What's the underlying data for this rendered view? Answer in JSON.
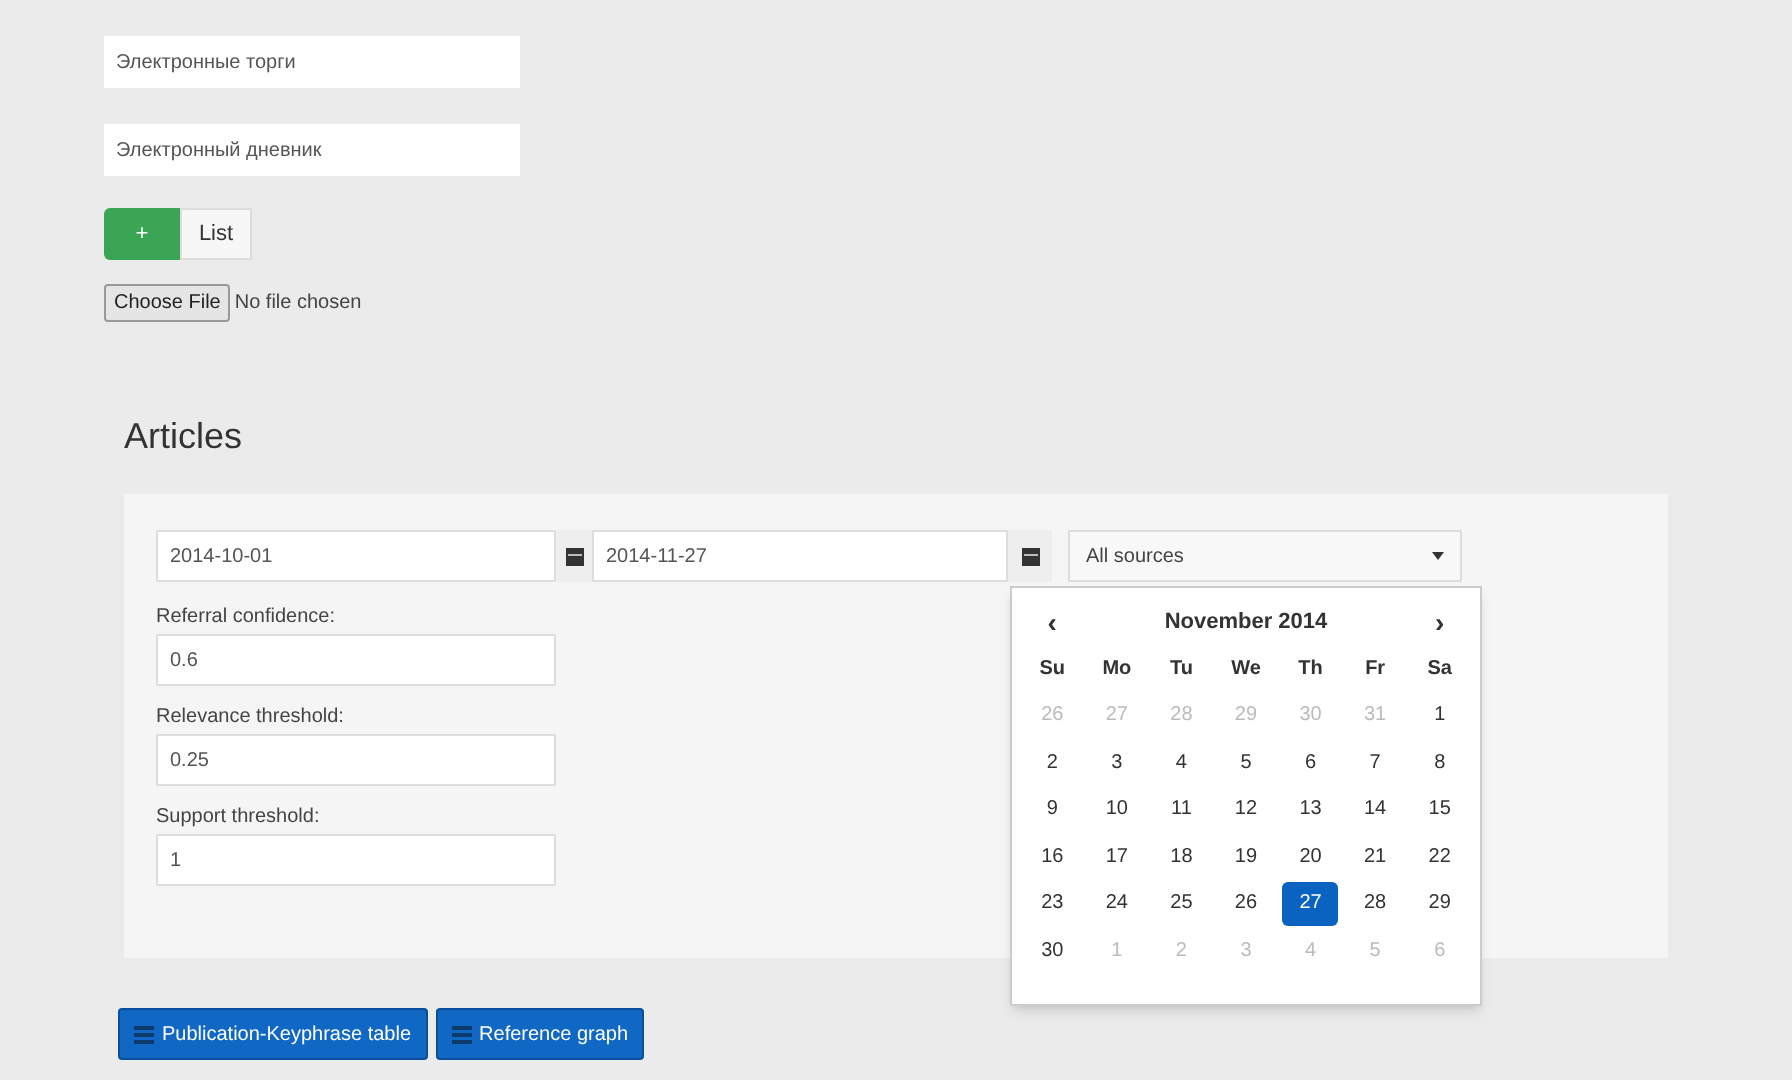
{
  "top_fields": [
    {
      "value": "Электронные торги"
    },
    {
      "value": "Электронный дневник"
    }
  ],
  "add_button": {
    "label": "+"
  },
  "list_button": {
    "label": "List"
  },
  "file_input": {
    "button": "Choose File",
    "status": "No file chosen"
  },
  "heading": "Articles",
  "filters": {
    "date_from": "2014-10-01",
    "date_to": "2014-11-27",
    "source": "All sources"
  },
  "params": [
    {
      "label": "Referral confidence:",
      "value": "0.6"
    },
    {
      "label": "Relevance threshold:",
      "value": "0.25"
    },
    {
      "label": "Support threshold:",
      "value": "1"
    }
  ],
  "calendar": {
    "prev": "‹",
    "title": "November 2014",
    "next": "›",
    "weekdays": [
      "Su",
      "Mo",
      "Tu",
      "We",
      "Th",
      "Fr",
      "Sa"
    ],
    "weeks": [
      [
        {
          "day": "26",
          "muted": true,
          "selected": false
        },
        {
          "day": "27",
          "muted": true,
          "selected": false
        },
        {
          "day": "28",
          "muted": true,
          "selected": false
        },
        {
          "day": "29",
          "muted": true,
          "selected": false
        },
        {
          "day": "30",
          "muted": true,
          "selected": false
        },
        {
          "day": "31",
          "muted": true,
          "selected": false
        },
        {
          "day": "1",
          "muted": false,
          "selected": false
        }
      ],
      [
        {
          "day": "2",
          "muted": false,
          "selected": false
        },
        {
          "day": "3",
          "muted": false,
          "selected": false
        },
        {
          "day": "4",
          "muted": false,
          "selected": false
        },
        {
          "day": "5",
          "muted": false,
          "selected": false
        },
        {
          "day": "6",
          "muted": false,
          "selected": false
        },
        {
          "day": "7",
          "muted": false,
          "selected": false
        },
        {
          "day": "8",
          "muted": false,
          "selected": false
        }
      ],
      [
        {
          "day": "9",
          "muted": false,
          "selected": false
        },
        {
          "day": "10",
          "muted": false,
          "selected": false
        },
        {
          "day": "11",
          "muted": false,
          "selected": false
        },
        {
          "day": "12",
          "muted": false,
          "selected": false
        },
        {
          "day": "13",
          "muted": false,
          "selected": false
        },
        {
          "day": "14",
          "muted": false,
          "selected": false
        },
        {
          "day": "15",
          "muted": false,
          "selected": false
        }
      ],
      [
        {
          "day": "16",
          "muted": false,
          "selected": false
        },
        {
          "day": "17",
          "muted": false,
          "selected": false
        },
        {
          "day": "18",
          "muted": false,
          "selected": false
        },
        {
          "day": "19",
          "muted": false,
          "selected": false
        },
        {
          "day": "20",
          "muted": false,
          "selected": false
        },
        {
          "day": "21",
          "muted": false,
          "selected": false
        },
        {
          "day": "22",
          "muted": false,
          "selected": false
        }
      ],
      [
        {
          "day": "23",
          "muted": false,
          "selected": false
        },
        {
          "day": "24",
          "muted": false,
          "selected": false
        },
        {
          "day": "25",
          "muted": false,
          "selected": false
        },
        {
          "day": "26",
          "muted": false,
          "selected": false
        },
        {
          "day": "27",
          "muted": false,
          "selected": true
        },
        {
          "day": "28",
          "muted": false,
          "selected": false
        },
        {
          "day": "29",
          "muted": false,
          "selected": false
        }
      ],
      [
        {
          "day": "30",
          "muted": false,
          "selected": false
        },
        {
          "day": "1",
          "muted": true,
          "selected": false
        },
        {
          "day": "2",
          "muted": true,
          "selected": false
        },
        {
          "day": "3",
          "muted": true,
          "selected": false
        },
        {
          "day": "4",
          "muted": true,
          "selected": false
        },
        {
          "day": "5",
          "muted": true,
          "selected": false
        },
        {
          "day": "6",
          "muted": true,
          "selected": false
        }
      ]
    ]
  },
  "actions": [
    {
      "label": "Publication-Keyphrase table"
    },
    {
      "label": "Reference graph"
    }
  ]
}
